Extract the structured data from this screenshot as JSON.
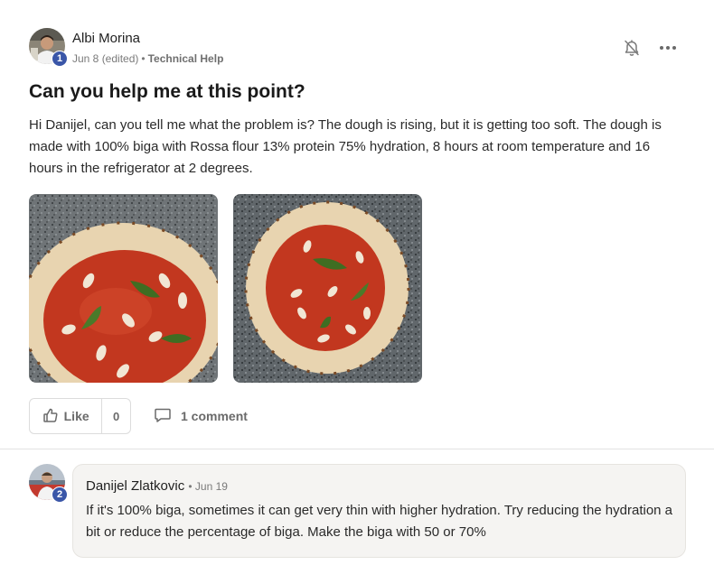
{
  "post": {
    "author": {
      "name": "Albi Morina",
      "level": "1"
    },
    "meta": {
      "date": "Jun 8 (edited)",
      "separator": "•",
      "category": "Technical Help"
    },
    "icons": {
      "notify": "bell-off-icon",
      "more": "more-horizontal-icon"
    },
    "title": "Can you help me at this point?",
    "body": "Hi Danijel, can you tell me what the problem is? The dough is rising, but it is getting too soft. The dough is made with 100% biga with Rossa flour 13% protein 75% hydration, 8 hours at room temperature and 16 hours in the refrigerator at 2 degrees.",
    "images": [
      {
        "alt": "pizza-photo-closeup"
      },
      {
        "alt": "pizza-photo-overhead"
      }
    ],
    "actions": {
      "like_label": "Like",
      "like_count": "0",
      "comment_label": "1 comment"
    }
  },
  "comment": {
    "author": {
      "name": "Danijel Zlatkovic",
      "level": "2"
    },
    "date": "• Jun 19",
    "text": "If it's 100% biga, sometimes it can get very thin with higher hydration. Try reducing the hydration a bit or reduce the percentage of biga. Make the biga with 50 or 70%"
  },
  "colors": {
    "badge": "#3a56a8",
    "sauce": "#c33a24",
    "crust": "#e9d6b4",
    "granite": "#6d7275"
  }
}
